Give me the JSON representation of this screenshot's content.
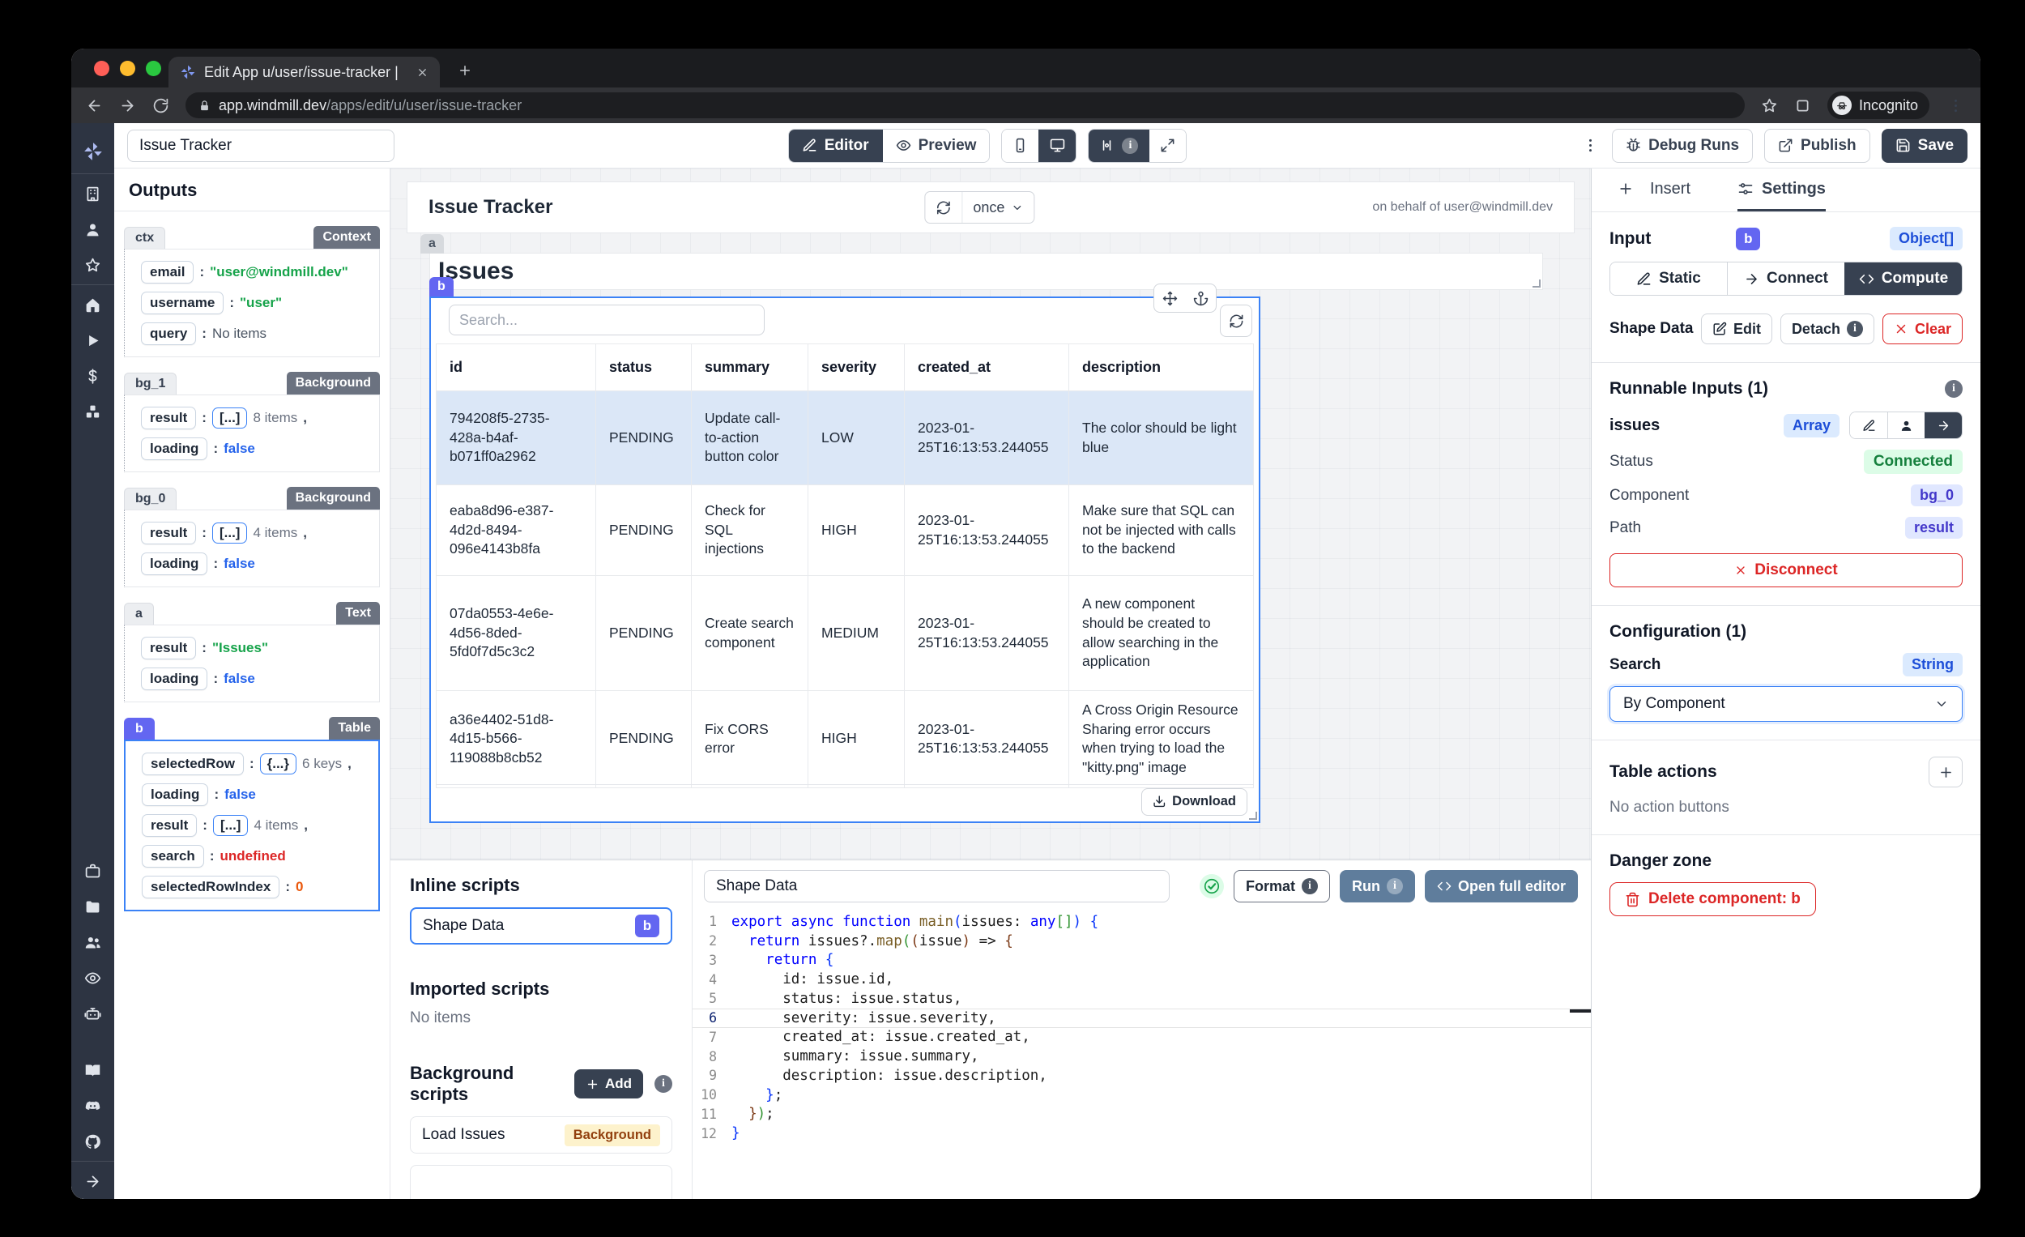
{
  "colors": {
    "accent_indigo": "#6366f1",
    "selection_blue": "#3b82f6",
    "danger_red": "#dc2626",
    "dark_button": "#374151",
    "connected_green_bg": "#dcfce7",
    "badge_blue_bg": "#dbeafe",
    "background_badge_yellow_bg": "#fdf2cc",
    "selected_row_blue": "#dbe7f7",
    "traffic_lights": [
      "#ff5f57",
      "#febc2e",
      "#2ac840"
    ]
  },
  "browser": {
    "tab_title": "Edit App u/user/issue-tracker |",
    "url_domain": "app.windmill.dev",
    "url_path": "/apps/edit/u/user/issue-tracker",
    "incognito_label": "Incognito"
  },
  "toolbar": {
    "app_name": "Issue Tracker",
    "editor_label": "Editor",
    "preview_label": "Preview",
    "debug_label": "Debug Runs",
    "publish_label": "Publish",
    "save_label": "Save"
  },
  "sidebar": {
    "items": [
      {
        "icon": "windmill-logo"
      },
      {
        "divider": true
      },
      {
        "icon": "workspace-icon"
      },
      {
        "icon": "user-icon"
      },
      {
        "icon": "favorites-icon"
      },
      {
        "divider": true
      },
      {
        "icon": "home-icon"
      },
      {
        "icon": "runs-icon"
      },
      {
        "icon": "variables-icon"
      },
      {
        "icon": "resources-icon"
      },
      {
        "spacer": true
      },
      {
        "icon": "schedules-icon"
      },
      {
        "icon": "folders-icon"
      },
      {
        "icon": "groups-icon"
      },
      {
        "icon": "audit-logs-icon"
      },
      {
        "icon": "workers-icon"
      },
      {
        "gap": 26
      },
      {
        "icon": "docs-icon"
      },
      {
        "icon": "discord-icon"
      },
      {
        "icon": "github-icon"
      },
      {
        "divider": true
      },
      {
        "icon": "expand-sidebar-icon"
      }
    ]
  },
  "outputs": {
    "title": "Outputs",
    "sections": [
      {
        "id": "ctx",
        "type": "Context",
        "selected": false,
        "items": [
          {
            "key": "email",
            "value": "\"user@windmill.dev\"",
            "vclass": "green"
          },
          {
            "key": "username",
            "value": "\"user\"",
            "vclass": "green"
          },
          {
            "key": "query",
            "value": "No items",
            "vclass": "plain"
          }
        ]
      },
      {
        "id": "bg_1",
        "type": "Background",
        "selected": false,
        "items": [
          {
            "key": "result",
            "bracket": "[...]",
            "value": "8 items",
            "vclass": "muted",
            "comma": true
          },
          {
            "key": "loading",
            "value": "false",
            "vclass": "blue"
          }
        ]
      },
      {
        "id": "bg_0",
        "type": "Background",
        "selected": false,
        "items": [
          {
            "key": "result",
            "bracket": "[...]",
            "value": "4 items",
            "vclass": "muted",
            "comma": true
          },
          {
            "key": "loading",
            "value": "false",
            "vclass": "blue"
          }
        ]
      },
      {
        "id": "a",
        "type": "Text",
        "selected": false,
        "items": [
          {
            "key": "result",
            "value": "\"Issues\"",
            "vclass": "green"
          },
          {
            "key": "loading",
            "value": "false",
            "vclass": "blue"
          }
        ]
      },
      {
        "id": "b",
        "type": "Table",
        "selected": true,
        "items": [
          {
            "key": "selectedRow",
            "bracket": "{...}",
            "value": "6 keys",
            "vclass": "muted",
            "comma": true
          },
          {
            "key": "loading",
            "value": "false",
            "vclass": "blue"
          },
          {
            "key": "result",
            "bracket": "[...]",
            "value": "4 items",
            "vclass": "muted",
            "comma": true
          },
          {
            "key": "search",
            "value": "undefined",
            "vclass": "red"
          },
          {
            "key": "selectedRowIndex",
            "value": "0",
            "vclass": "orange"
          }
        ]
      }
    ]
  },
  "canvas": {
    "header": {
      "title": "Issue Tracker",
      "refresh_mode": "once",
      "on_behalf": "on behalf of user@windmill.dev"
    },
    "text_component": {
      "badge": "a",
      "text": "Issues"
    },
    "table_component": {
      "badge": "b",
      "search_placeholder": "Search...",
      "download_label": "Download",
      "columns": [
        "id",
        "status",
        "summary",
        "severity",
        "created_at",
        "description"
      ],
      "selected_row_index": 0,
      "rows": [
        [
          "794208f5-2735-428a-b4af-b071ff0a2962",
          "PENDING",
          "Update call-to-action button color",
          "LOW",
          "2023-01-25T16:13:53.244055",
          "The color should be light blue"
        ],
        [
          "eaba8d96-e387-4d2d-8494-096e4143b8fa",
          "PENDING",
          "Check for SQL injections",
          "HIGH",
          "2023-01-25T16:13:53.244055",
          "Make sure that SQL can not be injected with calls to the backend"
        ],
        [
          "07da0553-4e6e-4d56-8ded-5fd0f7d5c3c2",
          "PENDING",
          "Create search component",
          "MEDIUM",
          "2023-01-25T16:13:53.244055",
          "A new component should be created to allow searching in the application"
        ],
        [
          "a36e4402-51d8-4d15-b566-119088b8cb52",
          "PENDING",
          "Fix CORS error",
          "HIGH",
          "2023-01-25T16:13:53.244055",
          "A Cross Origin Resource Sharing error occurs when trying to load the \"kitty.png\" image"
        ]
      ]
    }
  },
  "scripts": {
    "inline_title": "Inline scripts",
    "inline_item_label": "Shape Data",
    "inline_item_badge": "b",
    "imported_title": "Imported scripts",
    "imported_empty": "No items",
    "background_title": "Background scripts",
    "add_label": "Add",
    "background_item_label": "Load Issues",
    "background_item_badge": "Background"
  },
  "editor": {
    "name_value": "Shape Data",
    "format_label": "Format",
    "run_label": "Run",
    "open_label": "Open full editor",
    "lines": [
      {
        "n": "1",
        "seg": [
          [
            "export",
            "kw"
          ],
          [
            " ",
            "tx"
          ],
          [
            "async",
            "kw"
          ],
          [
            " ",
            "tx"
          ],
          [
            "function",
            "kw"
          ],
          [
            " ",
            "tx"
          ],
          [
            "main",
            "fn"
          ],
          [
            "(",
            "b1"
          ],
          [
            "issues",
            "tx"
          ],
          [
            ": ",
            "tx"
          ],
          [
            "any",
            "kw"
          ],
          [
            "[]",
            "b2"
          ],
          [
            ")",
            "b1"
          ],
          [
            " ",
            "tx"
          ],
          [
            "{",
            "b1"
          ]
        ]
      },
      {
        "n": "2",
        "seg": [
          [
            "  ",
            "tx"
          ],
          [
            "return",
            "kw"
          ],
          [
            " issues?.",
            "tx"
          ],
          [
            "map",
            "fn"
          ],
          [
            "(",
            "b2"
          ],
          [
            "(",
            "b3"
          ],
          [
            "issue",
            "tx"
          ],
          [
            ")",
            "b3"
          ],
          [
            " => ",
            "tx"
          ],
          [
            "{",
            "b3"
          ]
        ]
      },
      {
        "n": "3",
        "seg": [
          [
            "    ",
            "tx"
          ],
          [
            "return",
            "kw"
          ],
          [
            " ",
            "tx"
          ],
          [
            "{",
            "b1"
          ]
        ]
      },
      {
        "n": "4",
        "seg": [
          [
            "      id: issue.id,",
            "tx"
          ]
        ]
      },
      {
        "n": "5",
        "seg": [
          [
            "      status: issue.status,",
            "tx"
          ]
        ]
      },
      {
        "n": "6",
        "active": true,
        "seg": [
          [
            "      severity: issue.severity,",
            "tx"
          ]
        ]
      },
      {
        "n": "7",
        "seg": [
          [
            "      created_at: issue.created_at,",
            "tx"
          ]
        ]
      },
      {
        "n": "8",
        "seg": [
          [
            "      summary: issue.summary,",
            "tx"
          ]
        ]
      },
      {
        "n": "9",
        "seg": [
          [
            "      description: issue.description,",
            "tx"
          ]
        ]
      },
      {
        "n": "10",
        "seg": [
          [
            "    ",
            "tx"
          ],
          [
            "}",
            "b1"
          ],
          [
            ";",
            "tx"
          ]
        ]
      },
      {
        "n": "11",
        "seg": [
          [
            "  ",
            "tx"
          ],
          [
            "}",
            "b3"
          ],
          [
            ")",
            "b2"
          ],
          [
            ";",
            "tx"
          ]
        ]
      },
      {
        "n": "12",
        "seg": [
          [
            "}",
            "b1"
          ]
        ]
      }
    ]
  },
  "settings": {
    "insert_tab": "Insert",
    "settings_tab": "Settings",
    "input_label": "Input",
    "component_badge": "b",
    "type_badge": "Object[]",
    "mode_static": "Static",
    "mode_connect": "Connect",
    "mode_compute": "Compute",
    "shape_data_label": "Shape Data",
    "edit_label": "Edit",
    "detach_label": "Detach",
    "clear_label": "Clear",
    "runnable_title": "Runnable Inputs (1)",
    "issues_label": "issues",
    "array_badge": "Array",
    "status_label": "Status",
    "status_value": "Connected",
    "component_label": "Component",
    "component_value": "bg_0",
    "path_label": "Path",
    "path_value": "result",
    "disconnect_label": "Disconnect",
    "config_title": "Configuration (1)",
    "search_label": "Search",
    "search_type_badge": "String",
    "search_value": "By Component",
    "table_actions_title": "Table actions",
    "table_actions_empty": "No action buttons",
    "danger_title": "Danger zone",
    "delete_label": "Delete component: b"
  }
}
